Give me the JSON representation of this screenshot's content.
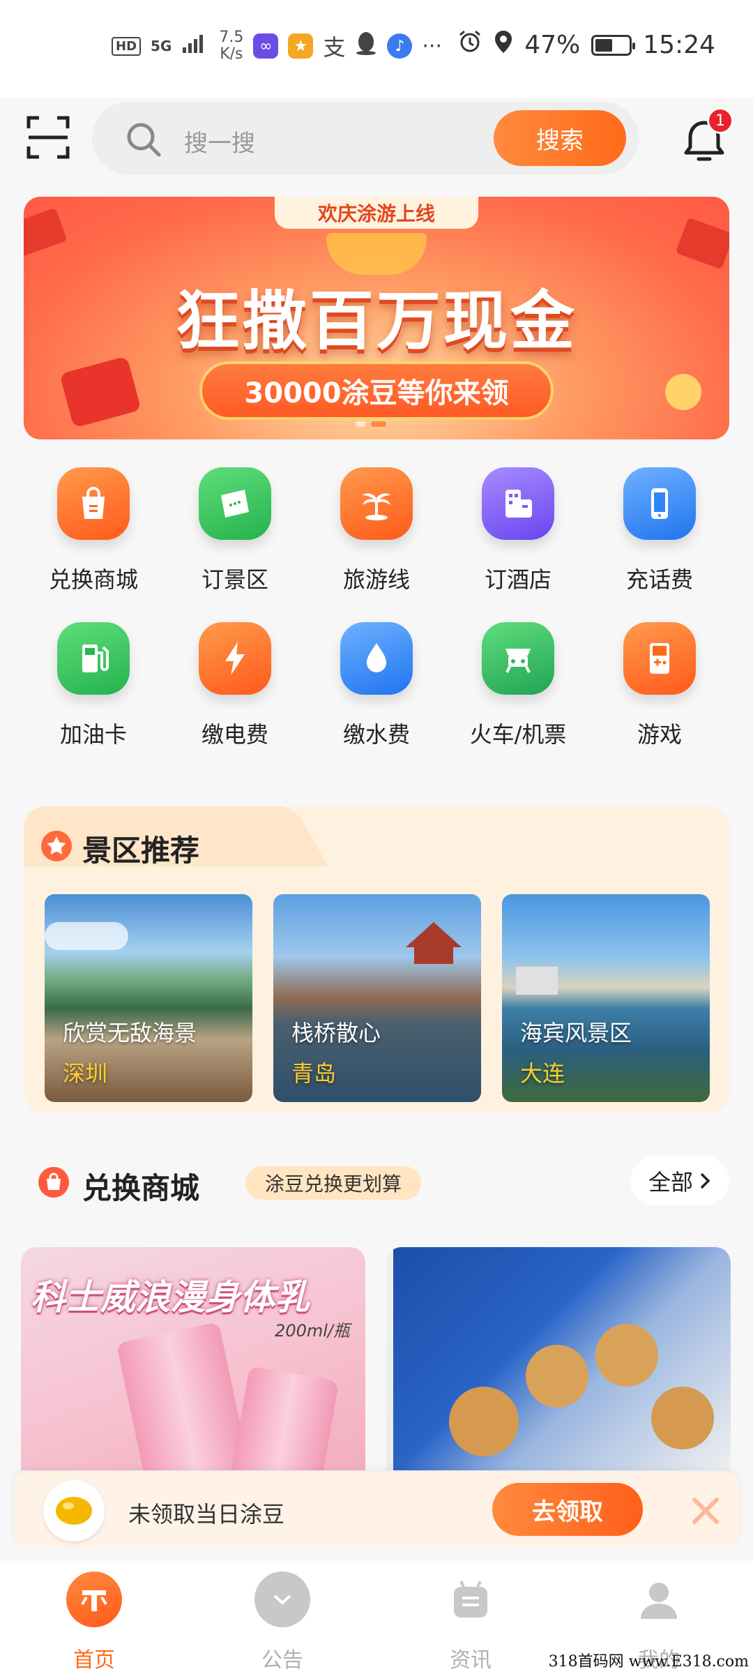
{
  "status_bar": {
    "hd": "HD",
    "network": "5G",
    "speed_top": "7.5",
    "speed_unit": "K/s",
    "more": "···",
    "battery": "47%",
    "time": "15:24",
    "battery_level": 0.47
  },
  "header": {
    "search_placeholder": "搜一搜",
    "search_button": "搜索",
    "notification_count": "1"
  },
  "banner": {
    "tag": "欢庆涂游上线",
    "title": "狂撒百万现金",
    "subtitle": "30000涂豆等你来领"
  },
  "grid": {
    "items": [
      {
        "label": "兑换商城",
        "icon": "shopping-bag-icon",
        "color": "#ff6a1a"
      },
      {
        "label": "订景区",
        "icon": "ticket-icon",
        "color": "#35c15a"
      },
      {
        "label": "旅游线",
        "icon": "palm-tree-icon",
        "color": "#ff6a1a"
      },
      {
        "label": "订酒店",
        "icon": "hotel-icon",
        "color": "#7b5cf5"
      },
      {
        "label": "充话费",
        "icon": "phone-icon",
        "color": "#2f86f7"
      },
      {
        "label": "加油卡",
        "icon": "fuel-icon",
        "color": "#35c15a"
      },
      {
        "label": "缴电费",
        "icon": "lightning-icon",
        "color": "#ff6a1a"
      },
      {
        "label": "缴水费",
        "icon": "water-drop-icon",
        "color": "#2f86f7"
      },
      {
        "label": "火车/机票",
        "icon": "train-icon",
        "color": "#35b56a"
      },
      {
        "label": "游戏",
        "icon": "game-icon",
        "color": "#ff6a1a"
      }
    ]
  },
  "scenic": {
    "title": "景区推荐",
    "cards": [
      {
        "name": "欣赏无敌海景",
        "city": "深圳"
      },
      {
        "name": "栈桥散心",
        "city": "青岛"
      },
      {
        "name": "海宾风景区",
        "city": "大连"
      }
    ]
  },
  "mall": {
    "title": "兑换商城",
    "pill": "涂豆兑换更划算",
    "all": "全部",
    "product1_text": "科士威浪漫身体乳",
    "product1_sub": "200ml/瓶"
  },
  "notify": {
    "text": "未领取当日涂豆",
    "button": "去领取"
  },
  "nav": {
    "items": [
      {
        "label": "首页"
      },
      {
        "label": "公告"
      },
      {
        "label": "资讯"
      },
      {
        "label": "我的"
      }
    ]
  },
  "watermark": "318首码网 www.E318.com"
}
